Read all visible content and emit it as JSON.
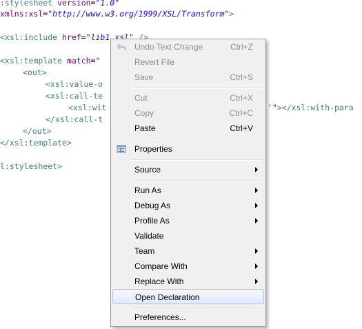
{
  "editor": {
    "line1": {
      "tag": ":stylesheet",
      "attr": " version",
      "eq": "=",
      "val": "\"1.0\""
    },
    "line2": {
      "attr": "xmlns:xsl",
      "eq": "=",
      "val": "\"http://www.w3.org/1999/XSL/Transform\"",
      "close": ">"
    },
    "line3": {
      "tag": "<xsl:include",
      "attr": " href",
      "eq": "=",
      "val": "\"lib1.xsl\"",
      "close": " />"
    },
    "line4": {
      "tag": "<xsl:template",
      "attr": " match",
      "eq": "=",
      "val": "\""
    },
    "line5": {
      "tag": "<out>"
    },
    "line6": {
      "tag": "<xsl:value-o"
    },
    "line7": {
      "tag": "<xsl:call-te"
    },
    "line8": {
      "tag": "<xsl:wit",
      "tail_val": "'\"",
      "tail_tag": "></xsl:with-para"
    },
    "line9": {
      "tag": "</xsl:call-t"
    },
    "line10": {
      "tag": "</out>"
    },
    "line11": {
      "tag": "</xsl:template>"
    },
    "line12": {
      "tag": "l:stylesheet>"
    }
  },
  "menu": {
    "undo": {
      "label": "Undo Text Change",
      "shortcut": "Ctrl+Z"
    },
    "revert": {
      "label": "Revert File"
    },
    "save": {
      "label": "Save",
      "shortcut": "Ctrl+S"
    },
    "cut": {
      "label": "Cut",
      "shortcut": "Ctrl+X"
    },
    "copy": {
      "label": "Copy",
      "shortcut": "Ctrl+C"
    },
    "paste": {
      "label": "Paste",
      "shortcut": "Ctrl+V"
    },
    "properties": {
      "label": "Properties"
    },
    "source": {
      "label": "Source"
    },
    "run_as": {
      "label": "Run As"
    },
    "debug_as": {
      "label": "Debug As"
    },
    "profile_as": {
      "label": "Profile As"
    },
    "validate": {
      "label": "Validate"
    },
    "team": {
      "label": "Team"
    },
    "compare_with": {
      "label": "Compare With"
    },
    "replace_with": {
      "label": "Replace With"
    },
    "open_declaration": {
      "label": "Open Declaration"
    },
    "preferences": {
      "label": "Preferences..."
    }
  },
  "icons": {
    "undo": "undo-arrow-icon",
    "properties": "properties-table-icon"
  },
  "colors": {
    "tag": "#3f7f7f",
    "attr": "#7f007f",
    "value": "#2a00ff",
    "highlight_border": "#a8c8ef",
    "menu_bg": "#f0f0f0",
    "disabled_text": "#8d8d8d"
  }
}
